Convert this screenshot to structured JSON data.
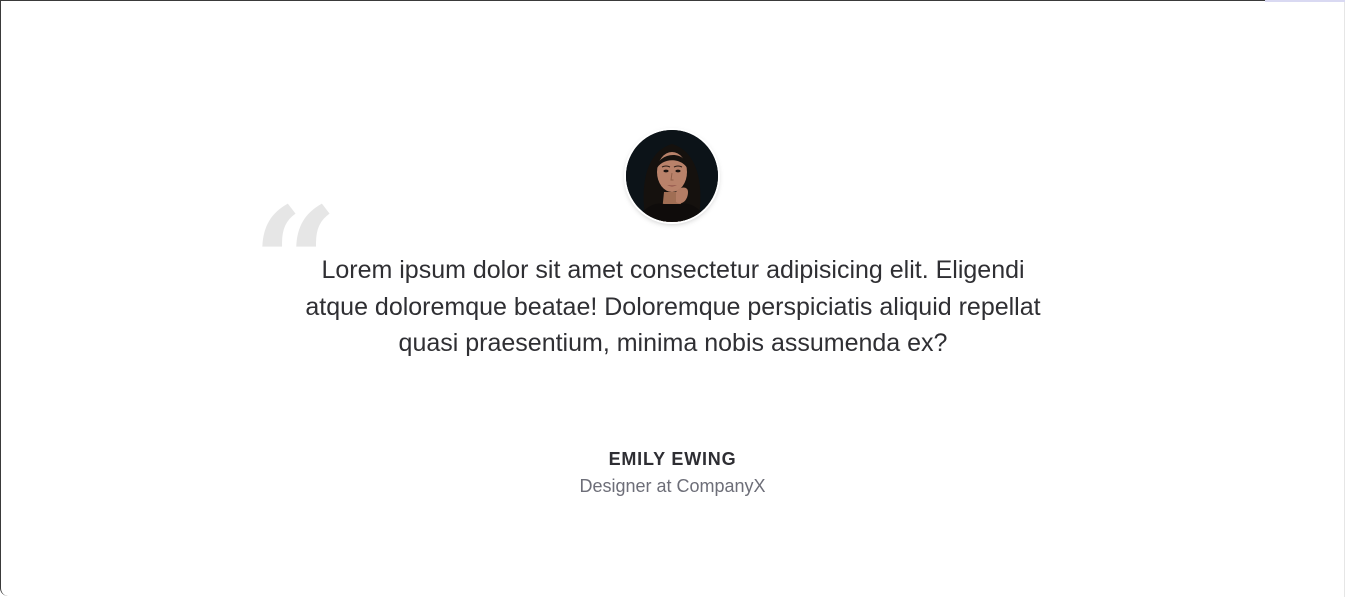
{
  "testimonial": {
    "quote_mark": "“",
    "quote": "Lorem ipsum dolor sit amet consectetur adipisicing elit. Eligendi atque doloremque beatae! Doloremque perspiciatis aliquid repellat quasi praesentium, minima nobis assumenda ex?",
    "author": {
      "name": "EMILY EWING",
      "role": "Designer at CompanyX"
    }
  },
  "colors": {
    "background": "#ffffff",
    "quote_text": "#2f2f33",
    "quote_mark": "#e6e6e6",
    "name": "#2e2e33",
    "role": "#6d6e78"
  }
}
